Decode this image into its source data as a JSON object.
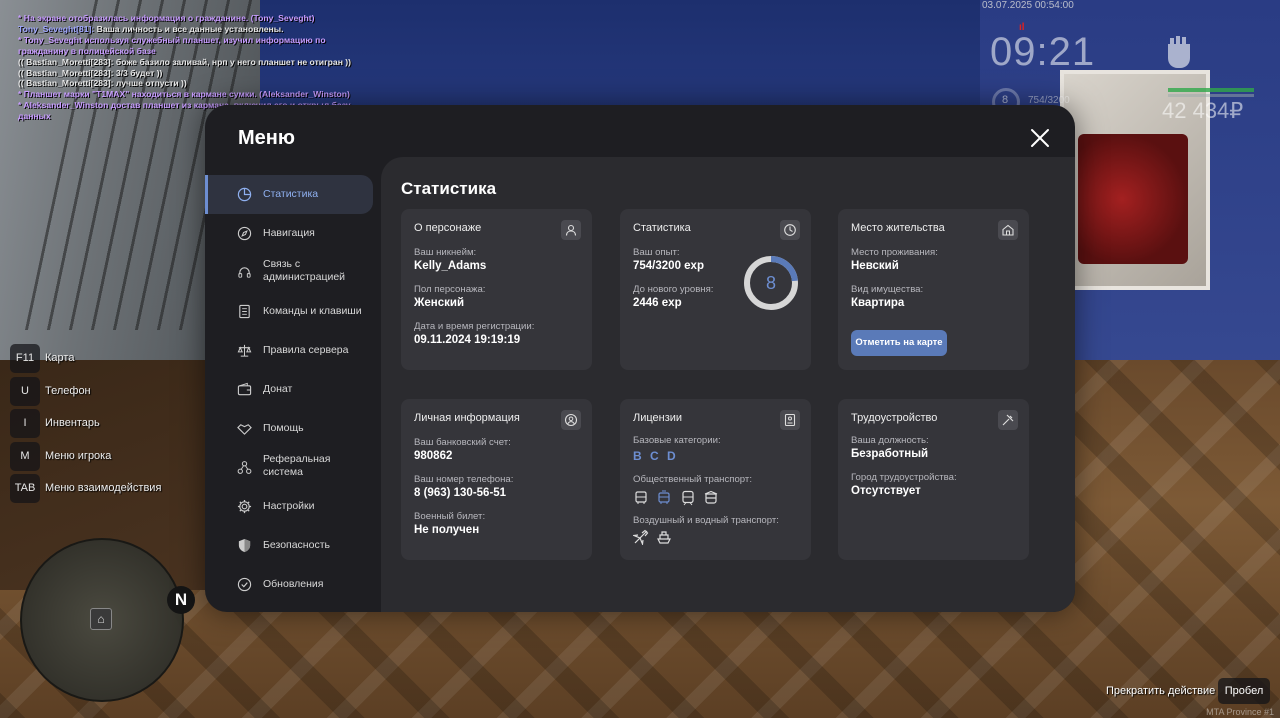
{
  "chat": [
    {
      "type": "me",
      "text": "* На экране отобразилась информация о гражданине. (Tony_Seveght)"
    },
    {
      "type": "nick",
      "nick": "Tony_Seveght[81]:",
      "text": " Ваша личность и все данные установлены."
    },
    {
      "type": "me",
      "text": "* Tony_Seveght используя служебный планшет, изучил информацию по гражданину в полицейской базе"
    },
    {
      "type": "plain",
      "text": "(( Bastian_Moretti[283]: боже базило заливай, нрп у него планшет не отигран ))"
    },
    {
      "type": "plain",
      "text": "(( Bastian_Moretti[283]: 3/3 будет ))"
    },
    {
      "type": "plain",
      "text": "(( Bastian_Moretti[283]: лучше отпусти ))"
    },
    {
      "type": "me",
      "text": "* Планшет марки \"T1MAX\" находиться в кармане сумки. (Aleksander_Winston)"
    },
    {
      "type": "me",
      "text": "* Aleksander_Winston достав планшет из кармана, включил его и открыл базу данных"
    }
  ],
  "hud": {
    "date": "03.07.2025 00:54:00",
    "time": "09:21",
    "level": "8",
    "exp": "754/3200",
    "money": "42 434₽",
    "fist_icon": "fist-icon"
  },
  "hotkeys": [
    {
      "key": "F11",
      "label": "Карта"
    },
    {
      "key": "U",
      "label": "Телефон"
    },
    {
      "key": "I",
      "label": "Инвентарь"
    },
    {
      "key": "M",
      "label": "Меню игрока"
    },
    {
      "key": "TAB",
      "label": "Меню взаимодействия"
    }
  ],
  "minimap": {
    "north": "N"
  },
  "bottom": {
    "stop_label": "Прекратить действие",
    "key_label": "Пробел",
    "server": "MTA Province #1"
  },
  "menu": {
    "title": "Меню",
    "nav": [
      {
        "label": "Статистика",
        "icon": "pie-chart-icon"
      },
      {
        "label": "Навигация",
        "icon": "compass-icon"
      },
      {
        "label": "Связь с администрацией",
        "icon": "headset-icon"
      },
      {
        "label": "Команды и клавиши",
        "icon": "document-icon"
      },
      {
        "label": "Правила сервера",
        "icon": "scales-icon"
      },
      {
        "label": "Донат",
        "icon": "wallet-icon"
      },
      {
        "label": "Помощь",
        "icon": "handshake-icon"
      },
      {
        "label": "Реферальная система",
        "icon": "referral-icon"
      },
      {
        "label": "Настройки",
        "icon": "gear-icon"
      },
      {
        "label": "Безопасность",
        "icon": "shield-icon"
      },
      {
        "label": "Обновления",
        "icon": "check-circle-icon"
      }
    ]
  },
  "stats": {
    "heading": "Статистика",
    "character": {
      "title": "О персонаже",
      "nick_label": "Ваш никнейм:",
      "nick": "Kelly_Adams",
      "gender_label": "Пол персонажа:",
      "gender": "Женский",
      "reg_label": "Дата и время регистрации:",
      "reg": "09.11.2024 19:19:19"
    },
    "stat": {
      "title": "Статистика",
      "exp_label": "Ваш опыт:",
      "exp": "754/3200 exp",
      "next_label": "До нового уровня:",
      "next": "2446 exp",
      "level": "8",
      "progress": 0.2356
    },
    "residence": {
      "title": "Место жительства",
      "place_label": "Место проживания:",
      "place": "Невский",
      "type_label": "Вид имущества:",
      "type": "Квартира",
      "button": "Отметить на карте"
    },
    "personal": {
      "title": "Личная информация",
      "bank_label": "Ваш банковский счет:",
      "bank": "980862",
      "phone_label": "Ваш номер телефона:",
      "phone": "8 (963) 130-56-51",
      "military_label": "Военный билет:",
      "military": "Не получен"
    },
    "licenses": {
      "title": "Лицензии",
      "base_label": "Базовые категории:",
      "categories": [
        "B",
        "C",
        "D"
      ],
      "public_label": "Общественный транспорт:",
      "air_label": "Воздушный и водный транспорт:"
    },
    "employment": {
      "title": "Трудоустройство",
      "position_label": "Ваша должность:",
      "position": "Безработный",
      "city_label": "Город трудоустройства:",
      "city": "Отсутствует"
    }
  }
}
